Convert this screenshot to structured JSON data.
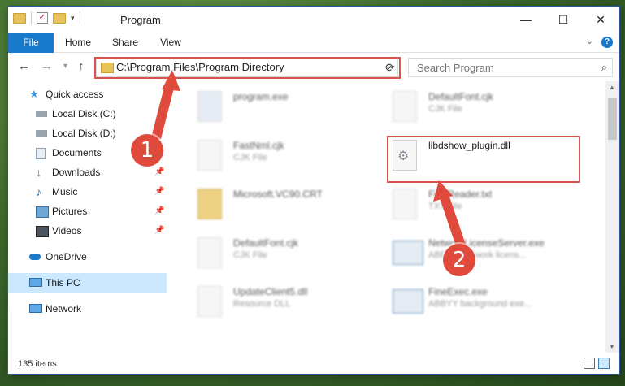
{
  "window": {
    "title": "Program",
    "controls": [
      "—",
      "☐",
      "✕"
    ]
  },
  "ribbon": {
    "tabs": [
      "File",
      "Home",
      "Share",
      "View"
    ],
    "help": "?"
  },
  "address": {
    "path": "C:\\Program Files\\Program Directory",
    "search_placeholder": "Search Program"
  },
  "sidebar": {
    "items": [
      {
        "label": "Quick access",
        "icon": "star-icon"
      },
      {
        "label": "Local Disk (C:)",
        "icon": "drive-icon"
      },
      {
        "label": "Local Disk (D:)",
        "icon": "drive-icon"
      },
      {
        "label": "Documents",
        "icon": "documents-icon"
      },
      {
        "label": "Downloads",
        "icon": "download-icon"
      },
      {
        "label": "Music",
        "icon": "music-icon"
      },
      {
        "label": "Pictures",
        "icon": "pictures-icon"
      },
      {
        "label": "Videos",
        "icon": "videos-icon"
      },
      {
        "label": "OneDrive",
        "icon": "cloud-icon"
      },
      {
        "label": "This PC",
        "icon": "computer-icon"
      },
      {
        "label": "Network",
        "icon": "network-icon"
      }
    ]
  },
  "files": [
    {
      "name": "program.exe",
      "type": ""
    },
    {
      "name": "DefaultFont.cjk",
      "type": "CJK File"
    },
    {
      "name": "FastNml.cjk",
      "type": "CJK File"
    },
    {
      "name": "libdshow_plugin.dll",
      "type": ""
    },
    {
      "name": "Microsoft.VC90.CRT",
      "type": ""
    },
    {
      "name": "FineReader.txt",
      "type": "TXT File"
    },
    {
      "name": "DefaultFont.cjk",
      "type": "CJK File"
    },
    {
      "name": "NetworkLicenseServer.exe",
      "type": "ABBYY Network licens..."
    },
    {
      "name": "UpdateClient5.dll",
      "type": "Resource DLL"
    },
    {
      "name": "FineExec.exe",
      "type": "ABBYY background exe..."
    }
  ],
  "status": {
    "count": "135 items"
  },
  "callouts": [
    "1",
    "2"
  ],
  "colors": {
    "accent": "#1979ca",
    "highlight": "#d9534f",
    "callout": "#e04a3d",
    "selection": "#cce8ff"
  }
}
